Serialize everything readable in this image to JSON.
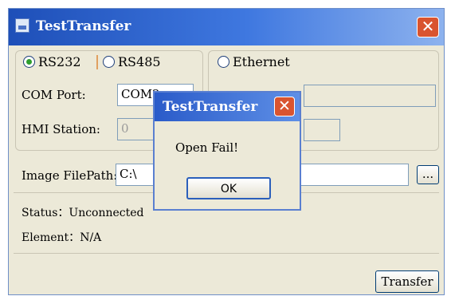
{
  "window": {
    "title": "TestTransfer",
    "close_symbol": "✕"
  },
  "connection": {
    "rs232_label": "RS232",
    "rs485_label": "RS485",
    "ethernet_label": "Ethernet",
    "selected": "RS232"
  },
  "com_port": {
    "label": "COM Port:",
    "value": "COM2"
  },
  "hmi_station": {
    "label": "HMI Station:",
    "value": "0"
  },
  "image_filepath": {
    "label": "Image FilePath:",
    "value": "C:\\",
    "browse_label": "..."
  },
  "status": {
    "label": "Status：",
    "value": "Unconnected"
  },
  "element": {
    "label": "Element：",
    "value": "N/A"
  },
  "transfer_button": "Transfer",
  "dialog": {
    "title": "TestTransfer",
    "message": "Open Fail!",
    "ok_label": "OK",
    "close_symbol": "✕"
  }
}
